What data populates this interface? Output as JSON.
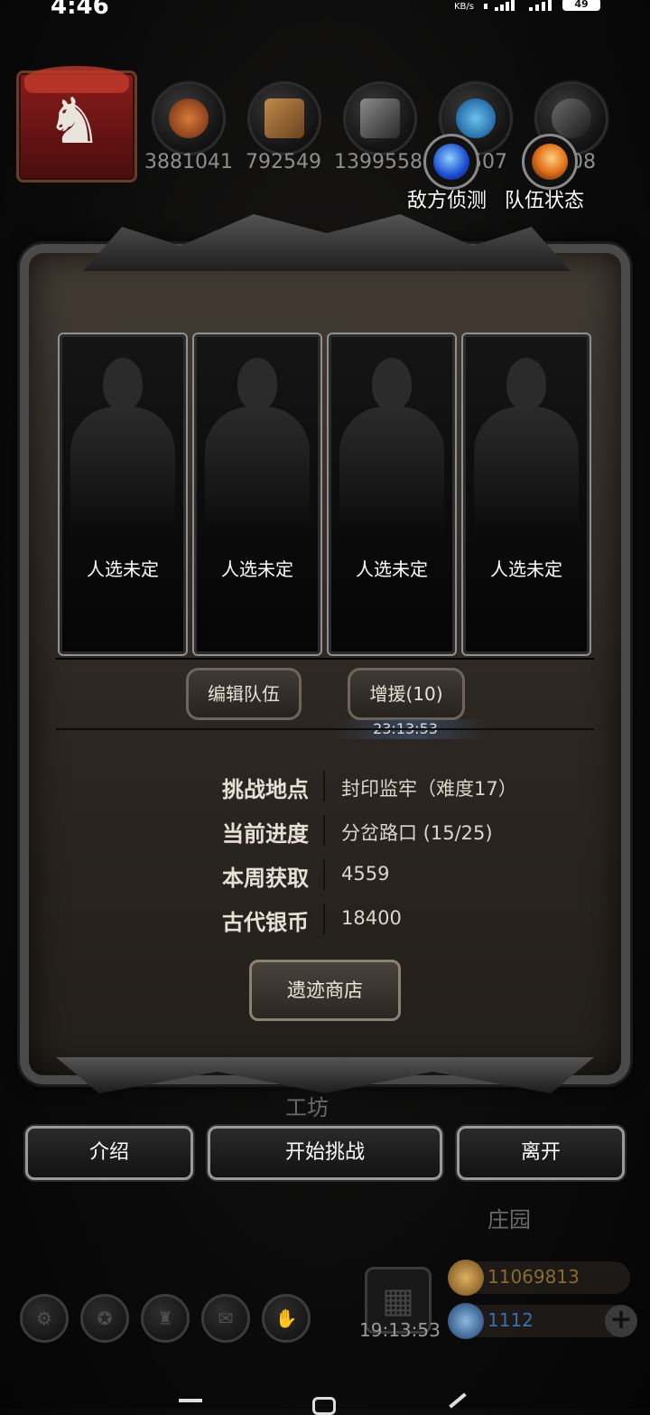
{
  "status": {
    "time": "4:46",
    "net": "KB/s",
    "battery": "49"
  },
  "resources": [
    {
      "name": "meat",
      "icon": "meat-icon",
      "color": "#c4602a",
      "value": "3881041"
    },
    {
      "name": "wood",
      "icon": "wood-icon",
      "color": "#a06a34",
      "value": "792549"
    },
    {
      "name": "iron",
      "icon": "iron-icon",
      "color": "#6a6a6a",
      "value": "1399558"
    },
    {
      "name": "feather",
      "icon": "feather-icon",
      "color": "#3aa0e0",
      "value": "507"
    },
    {
      "name": "stone",
      "icon": "stone-icon",
      "color": "#555555",
      "value": "08"
    }
  ],
  "top_buttons": {
    "enemy_scout": {
      "label": "敌方侦测",
      "icon": "blue-orb-icon",
      "color": "#2a6ae0"
    },
    "team_status": {
      "label": "队伍状态",
      "icon": "fire-orb-icon",
      "color": "#e0701a"
    }
  },
  "slots": [
    {
      "label": "人选未定"
    },
    {
      "label": "人选未定"
    },
    {
      "label": "人选未定"
    },
    {
      "label": "人选未定"
    }
  ],
  "panel_buttons": {
    "edit_team": "编辑队伍",
    "reinforce": "增援(10)",
    "timer": "23:13:53"
  },
  "info": [
    {
      "key": "挑战地点",
      "value": "封印监牢（难度17）"
    },
    {
      "key": "当前进度",
      "value": "分岔路口 (15/25)"
    },
    {
      "key": "本周获取",
      "value": "4559"
    },
    {
      "key": "古代银币",
      "value": "18400"
    }
  ],
  "shop_button": "遗迹商店",
  "actions": {
    "intro": "介绍",
    "start": "开始挑战",
    "leave": "离开"
  },
  "background_labels": {
    "workshop": "工坊",
    "manor": "庄园"
  },
  "bottom": {
    "gift_timer": "19:13:53",
    "gold": {
      "value": "11069813",
      "color": "#b88a3a",
      "icon": "gold-coin-icon"
    },
    "gem": {
      "value": "1112",
      "color": "#3a6fb0",
      "icon": "gem-icon"
    },
    "icons": [
      "settings-icon",
      "achievement-icon",
      "ranking-icon",
      "mail-icon",
      "handshake-icon"
    ]
  }
}
